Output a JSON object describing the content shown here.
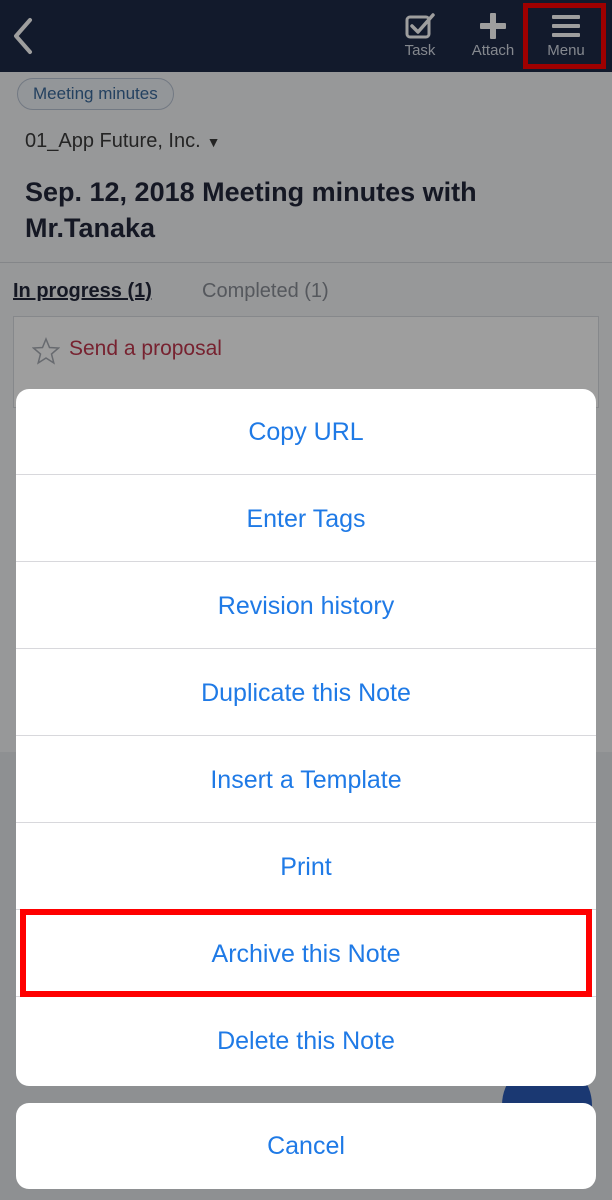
{
  "header": {
    "task_label": "Task",
    "attach_label": "Attach",
    "menu_label": "Menu",
    "background": "#1d2a48"
  },
  "note": {
    "tag": "Meeting minutes",
    "company": "01_App Future, Inc.",
    "title": "Sep. 12, 2018 Meeting minutes with Mr.Tanaka"
  },
  "tabs": {
    "in_progress": "In progress (1)",
    "completed": "Completed (1)"
  },
  "task": {
    "name": "Send a proposal",
    "color": "#c0384e"
  },
  "action_sheet": {
    "items": [
      "Copy URL",
      "Enter Tags",
      "Revision history",
      "Duplicate this Note",
      "Insert a Template",
      "Print",
      "Archive this Note",
      "Delete this Note"
    ],
    "cancel": "Cancel",
    "item_color": "#1f7ae6",
    "highlighted_item": "Archive this Note"
  },
  "highlight_color": "#ff0000"
}
